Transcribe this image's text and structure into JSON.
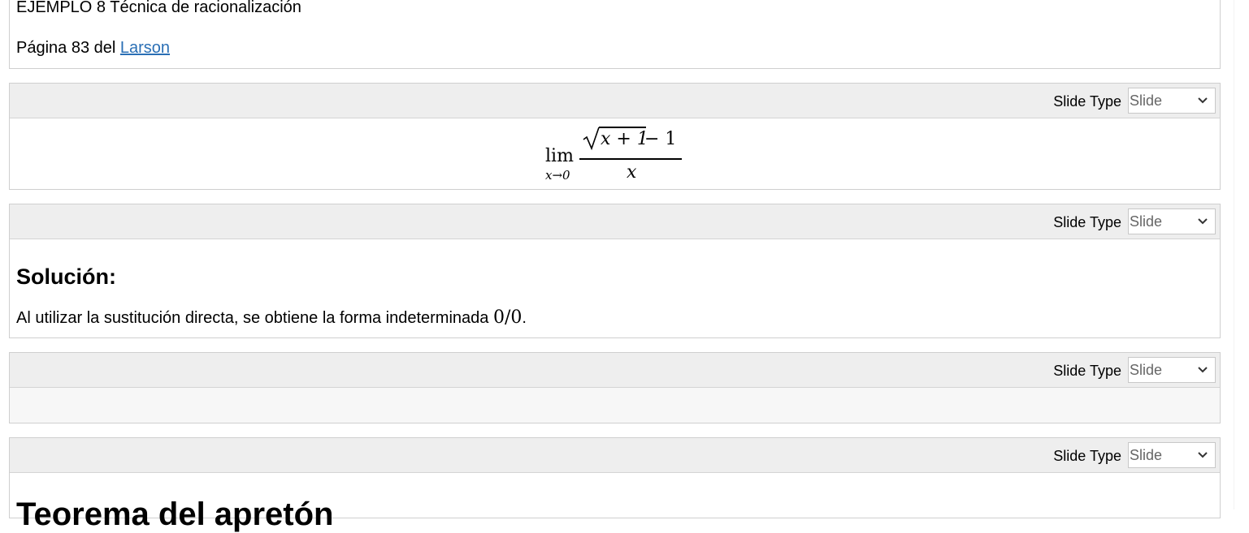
{
  "cells": [
    {
      "heading": "EJEMPLO 8 Técnica de racionalización",
      "page_text_prefix": "Página 83 del ",
      "page_link": "Larson"
    },
    {
      "slide_type_label": "Slide Type",
      "slide_type_value": "Slide",
      "formula": {
        "lim": "lim",
        "sub": "x→0",
        "radicand": "x + 1",
        "minus_one": " − 1",
        "denominator": "x"
      }
    },
    {
      "slide_type_label": "Slide Type",
      "slide_type_value": "Slide",
      "heading": "Solución:",
      "text_prefix": "Al utilizar la sustitución directa, se obtiene la forma indeterminada ",
      "text_math": "0/0",
      "text_suffix": "."
    },
    {
      "slide_type_label": "Slide Type",
      "slide_type_value": "Slide"
    },
    {
      "slide_type_label": "Slide Type",
      "slide_type_value": "Slide",
      "heading_partial": "Teorema del apretón"
    }
  ]
}
